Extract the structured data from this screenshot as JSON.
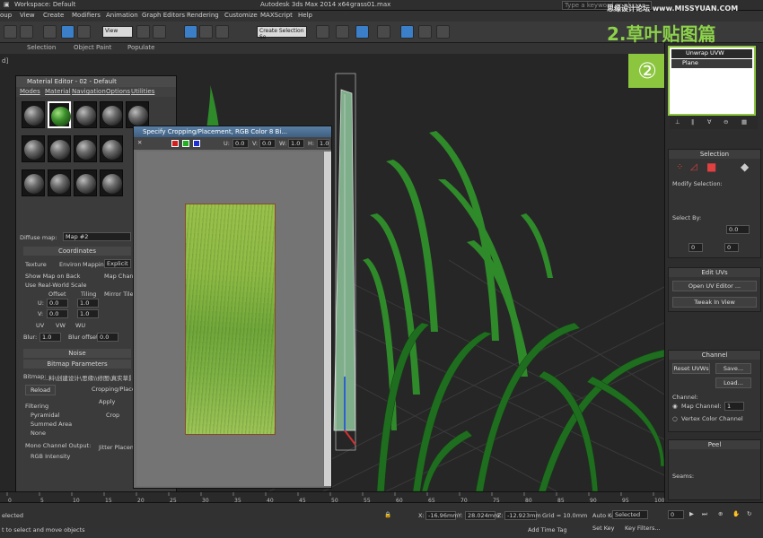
{
  "titlebar": {
    "app": "Workspace: Default",
    "left_menu": [
      "oup",
      "View",
      "Create",
      "Modifiers",
      "Animation",
      "Graph Editors",
      "Rendering",
      "Customize",
      "MAXScript",
      "Help"
    ],
    "product": "Autodesk 3ds Max 2014 x64",
    "file": "grass01.max",
    "search_placeholder": "Type a keyword or phrase"
  },
  "toolbar": {
    "view_select": "View",
    "selection_set": "Create Selection Se"
  },
  "ribbon": {
    "tabs": [
      "Selection",
      "Object Paint",
      "Populate"
    ]
  },
  "overlay": {
    "watermark": "思缘设计论坛 www.MISSYUAN.COM",
    "step_title": "2.草叶贴图篇",
    "step_badge": "②"
  },
  "modifier_stack": {
    "items": [
      "Unwrap UVW",
      "Plane"
    ]
  },
  "material_editor": {
    "title": "Material Editor - 02 - Default",
    "menu": [
      "Modes",
      "Material",
      "Navigation",
      "Options",
      "Utilities"
    ],
    "diffuse_label": "Diffuse map:",
    "diffuse_value": "Map #2",
    "coordinates_header": "Coordinates",
    "texture": "Texture",
    "environ": "Environ",
    "mapping_label": "Mapping:",
    "mapping_value": "Explicit Map C",
    "show_map": "Show Map on Back",
    "map_channel": "Map Channel",
    "real_world": "Use Real-World Scale",
    "offset": "Offset",
    "tiling": "Tiling",
    "mirror_tile": "Mirror Tile",
    "u_label": "U:",
    "v_label": "V:",
    "u_offset": "0.0",
    "v_offset": "0.0",
    "u_tiling": "1.0",
    "v_tiling": "1.0",
    "uv": "UV",
    "vw": "VW",
    "wu": "WU",
    "blur_label": "Blur:",
    "blur_value": "1.0",
    "blur_offset_label": "Blur offset:",
    "blur_offset_value": "0.0",
    "noise_header": "Noise",
    "bitmap_params_header": "Bitmap Parameters",
    "bitmap_label": "Bitmap:",
    "bitmap_path": "...料\\创建设计\\思缘\\\\修图\\真实草景\\",
    "reload": "Reload",
    "cropping": "Cropping/Placement",
    "apply": "Apply",
    "crop": "Crop",
    "filtering": "Filtering",
    "pyramidal": "Pyramidal",
    "summed_area": "Summed Area",
    "none": "None",
    "mono_output": "Mono Channel Output:",
    "rgb_intensity": "RGB Intensity",
    "jitter": "Jitter Placement"
  },
  "crop_window": {
    "title": "Specify Cropping/Placement, RGB Color 8 Bi...",
    "u_label": "U:",
    "u_value": "0.0",
    "v_label": "V:",
    "v_value": "0.0",
    "w_label": "W:",
    "w_value": "1.0",
    "h_label": "H:",
    "h_value": "1.0"
  },
  "command_panel": {
    "selection": "Selection",
    "modify_selection": "Modify Selection:",
    "select_by": "Select By:",
    "select_by_value": "0.0",
    "num1": "0",
    "num2": "0",
    "num3": "0",
    "edit_uvs": "Edit UVs",
    "open_uv_editor": "Open UV Editor ...",
    "tweak_in_view": "Tweak In View",
    "channel": "Channel",
    "reset_uvws": "Reset UVWs",
    "save": "Save...",
    "load": "Load...",
    "channel_label": "Channel:",
    "map_channel": "Map Channel:",
    "map_channel_value": "1",
    "vertex_color_channel": "Vertex Color Channel",
    "peel": "Peel",
    "seams": "Seams:"
  },
  "timeline": {
    "ticks": [
      "0",
      "5",
      "10",
      "15",
      "20",
      "25",
      "30",
      "35",
      "40",
      "45",
      "50",
      "55",
      "60",
      "65",
      "70",
      "75",
      "80",
      "85",
      "90",
      "95",
      "100"
    ]
  },
  "statusbar": {
    "selected": "elected",
    "prompt": "t to select and move objects",
    "x_label": "X:",
    "x_value": "-16.96mm",
    "y_label": "Y:",
    "y_value": "28.024mm",
    "z_label": "Z:",
    "z_value": "-12.923mm",
    "grid": "Grid = 10.0mm",
    "add_time_tag": "Add Time Tag",
    "auto_key": "Auto Key",
    "selected_value": "Selected",
    "set_key": "Set Key",
    "key_filters": "Key Filters...",
    "frame": "0"
  },
  "colors": {
    "accent_green": "#8cc63f",
    "grass": "#2f8a2a",
    "texture": "#8fbb45"
  }
}
